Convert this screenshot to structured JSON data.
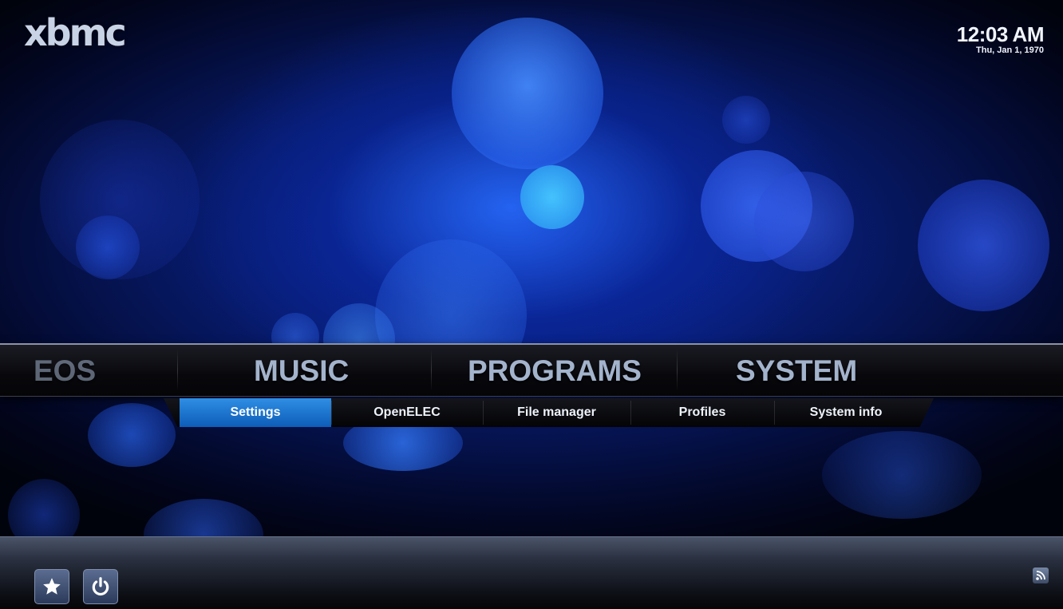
{
  "header": {
    "logo": "xbmc",
    "time": "12:03 AM",
    "date": "Thu, Jan 1, 1970"
  },
  "main_menu": {
    "items": [
      {
        "label": "EOS"
      },
      {
        "label": "MUSIC"
      },
      {
        "label": "PROGRAMS"
      },
      {
        "label": "SYSTEM"
      }
    ],
    "selected": "SYSTEM"
  },
  "submenu": {
    "items": [
      {
        "label": "Settings"
      },
      {
        "label": "OpenELEC"
      },
      {
        "label": "File manager"
      },
      {
        "label": "Profiles"
      },
      {
        "label": "System info"
      }
    ],
    "selected": "Settings"
  },
  "bottom_controls": {
    "favourites_icon": "star-icon",
    "power_icon": "power-icon",
    "rss_icon": "rss-icon"
  },
  "colors": {
    "accent": "#1f7fd8",
    "menu_text": "#a3b3cc",
    "background": "#0d2aa8"
  }
}
